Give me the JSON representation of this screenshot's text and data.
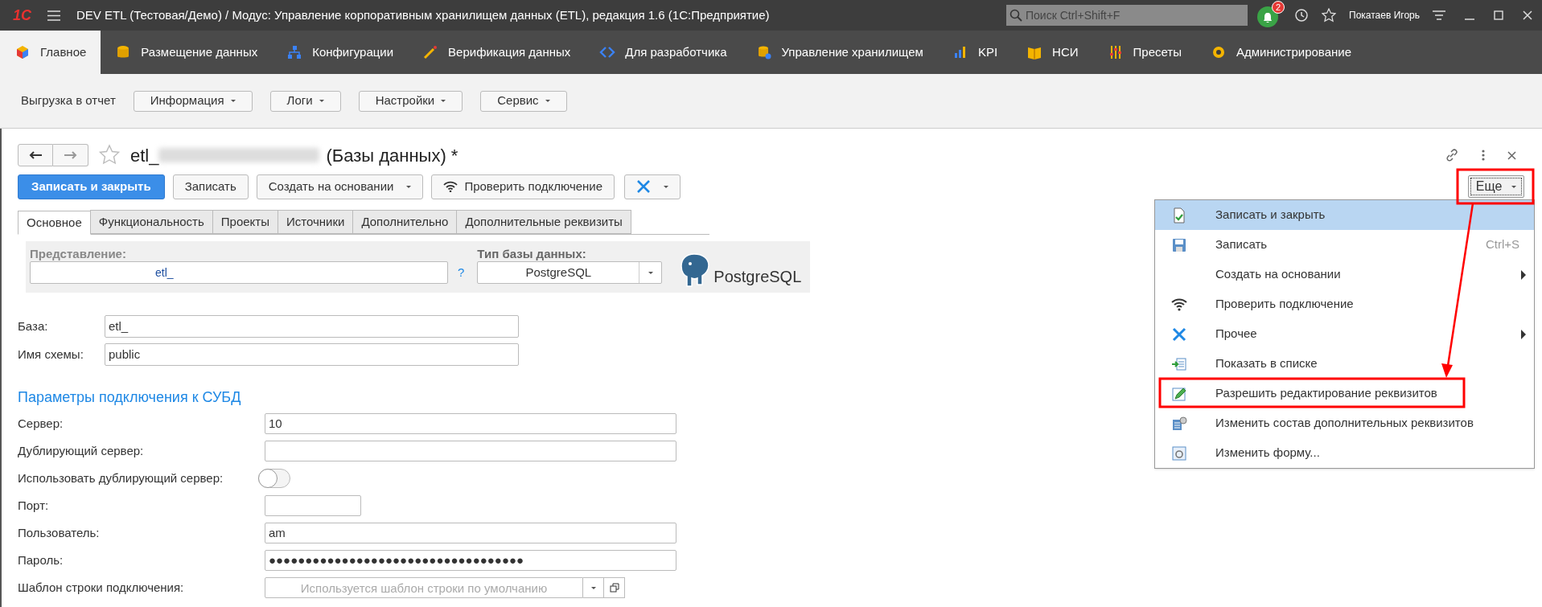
{
  "app": {
    "logo": "1С",
    "title": "DEV ETL (Тестовая/Демо) / Модус: Управление корпоративным хранилищем данных (ETL), редакция 1.6  (1С:Предприятие)",
    "search_placeholder": "Поиск Ctrl+Shift+F",
    "notifications": "2",
    "user": "Покатаев Игорь"
  },
  "sections": [
    {
      "label": "Главное",
      "selected": true
    },
    {
      "label": "Размещение данных",
      "selected": false
    },
    {
      "label": "Конфигурации",
      "selected": false
    },
    {
      "label": "Верификация данных",
      "selected": false
    },
    {
      "label": "Для разработчика",
      "selected": false
    },
    {
      "label": "Управление хранилищем",
      "selected": false
    },
    {
      "label": "KPI",
      "selected": false
    },
    {
      "label": "НСИ",
      "selected": false
    },
    {
      "label": "Пресеты",
      "selected": false
    },
    {
      "label": "Администрирование",
      "selected": false
    }
  ],
  "command_bar": {
    "label": "Выгрузка в отчет",
    "menus": [
      "Информация",
      "Логи",
      "Настройки",
      "Сервис"
    ]
  },
  "form": {
    "title": "etl_",
    "title_rest": "(Базы данных) *",
    "more_button": "Еще",
    "buttons": [
      {
        "kind": "primary",
        "label": "Записать и закрыть"
      },
      {
        "kind": "plain",
        "label": "Записать"
      },
      {
        "kind": "dropdown",
        "label": "Создать на основании"
      },
      {
        "kind": "wifi",
        "label": "Проверить подключение"
      },
      {
        "kind": "tools"
      }
    ],
    "tabs": [
      {
        "label": "Основное",
        "selected": true
      },
      {
        "label": "Функциональность",
        "selected": false
      },
      {
        "label": "Проекты",
        "selected": false
      },
      {
        "label": "Источники",
        "selected": false
      },
      {
        "label": "Дополнительно",
        "selected": false
      },
      {
        "label": "Дополнительные реквизиты",
        "selected": false
      }
    ],
    "representation": {
      "label": "Представление:",
      "value": "etl_",
      "help": "?"
    },
    "db_type": {
      "label": "Тип базы данных:",
      "value": "PostgreSQL",
      "logo_text": "PostgreSQL"
    },
    "fields": [
      {
        "label": "База:",
        "value": "etl_"
      },
      {
        "label": "Имя схемы:",
        "value": "public"
      }
    ],
    "section_title": "Параметры подключения к СУБД",
    "connection": [
      {
        "kind": "text",
        "label": "Сервер:",
        "value": "10"
      },
      {
        "kind": "text",
        "label": "Дублирующий сервер:"
      },
      {
        "kind": "toggle",
        "label": "Использовать дублирующий сервер:",
        "on": false
      },
      {
        "kind": "short",
        "label": "Порт:"
      },
      {
        "kind": "text",
        "label": "Пользователь:",
        "value": "am"
      },
      {
        "kind": "text",
        "label": "Пароль:",
        "value": "●●●●●●●●●●●●●●●●●●●●●●●●●●●●●●●●●●●"
      },
      {
        "kind": "template",
        "label": "Шаблон строки подключения:",
        "placeholder": "Используется шаблон строки по умолчанию"
      }
    ]
  },
  "menu": [
    {
      "label": "Записать и закрыть",
      "selected": true,
      "submenu": false,
      "annotated": false
    },
    {
      "label": "Записать",
      "shortcut": "Ctrl+S",
      "selected": false,
      "submenu": false,
      "annotated": false
    },
    {
      "label": "Создать на основании",
      "selected": false,
      "submenu": true,
      "annotated": false
    },
    {
      "label": "Проверить подключение",
      "selected": false,
      "submenu": false,
      "annotated": false
    },
    {
      "label": "Прочее",
      "selected": false,
      "submenu": true,
      "annotated": false
    },
    {
      "label": "Показать в списке",
      "selected": false,
      "submenu": false,
      "annotated": false
    },
    {
      "label": "Разрешить редактирование реквизитов",
      "selected": false,
      "submenu": false,
      "annotated": true
    },
    {
      "label": "Изменить состав дополнительных реквизитов",
      "selected": false,
      "submenu": false,
      "annotated": false
    },
    {
      "label": "Изменить форму...",
      "selected": false,
      "submenu": false,
      "annotated": false
    }
  ]
}
